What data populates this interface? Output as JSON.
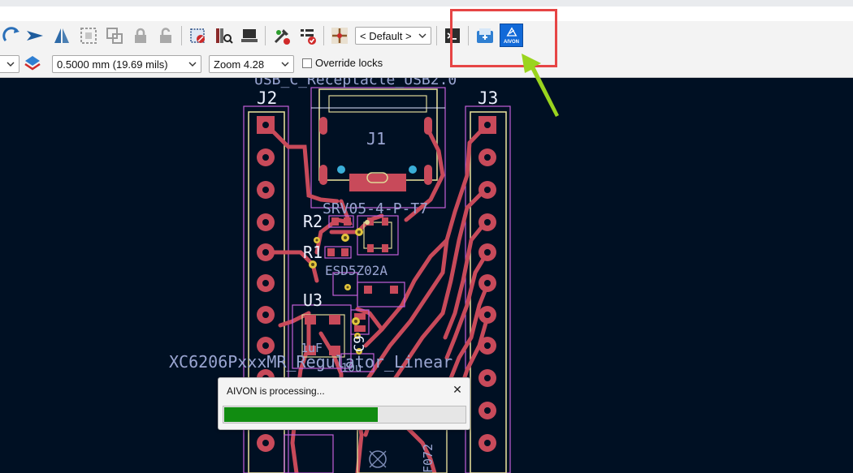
{
  "toolbar": {
    "layer_preset_select": {
      "value": "< Default >"
    }
  },
  "auxbar": {
    "grid_select": {
      "value": "0.5000 mm (19.69 mils)"
    },
    "zoom_select": {
      "value": "Zoom 4.28"
    },
    "override_locks": {
      "label": "Override locks",
      "checked": false
    }
  },
  "plugin": {
    "button_label": "AIVON"
  },
  "pcb": {
    "labels": {
      "j2": "J2",
      "j3": "J3",
      "j1": "J1",
      "r2": "R2",
      "r1": "R1",
      "u3": "U3",
      "c9": "C9",
      "top_fp": "USB_C_Receptacle_USB2.0",
      "usb_part": "SRV05-4-P-T7",
      "regulator_fp": "XC6206PxxxMR_Regulator_Linear",
      "ic_part": "ESD5Z02A",
      "cap_val": "1uF",
      "val_10u": "10u",
      "f0": "F072"
    },
    "colors": {
      "background": "#001023",
      "copper": "#c84a5a",
      "outline": "#e0d896",
      "courtyard": "#c35fd8",
      "silk": "#ecf1ff"
    }
  },
  "dialog": {
    "title": "AIVON is processing...",
    "close_label": "✕",
    "progress_fraction": 0.64
  }
}
